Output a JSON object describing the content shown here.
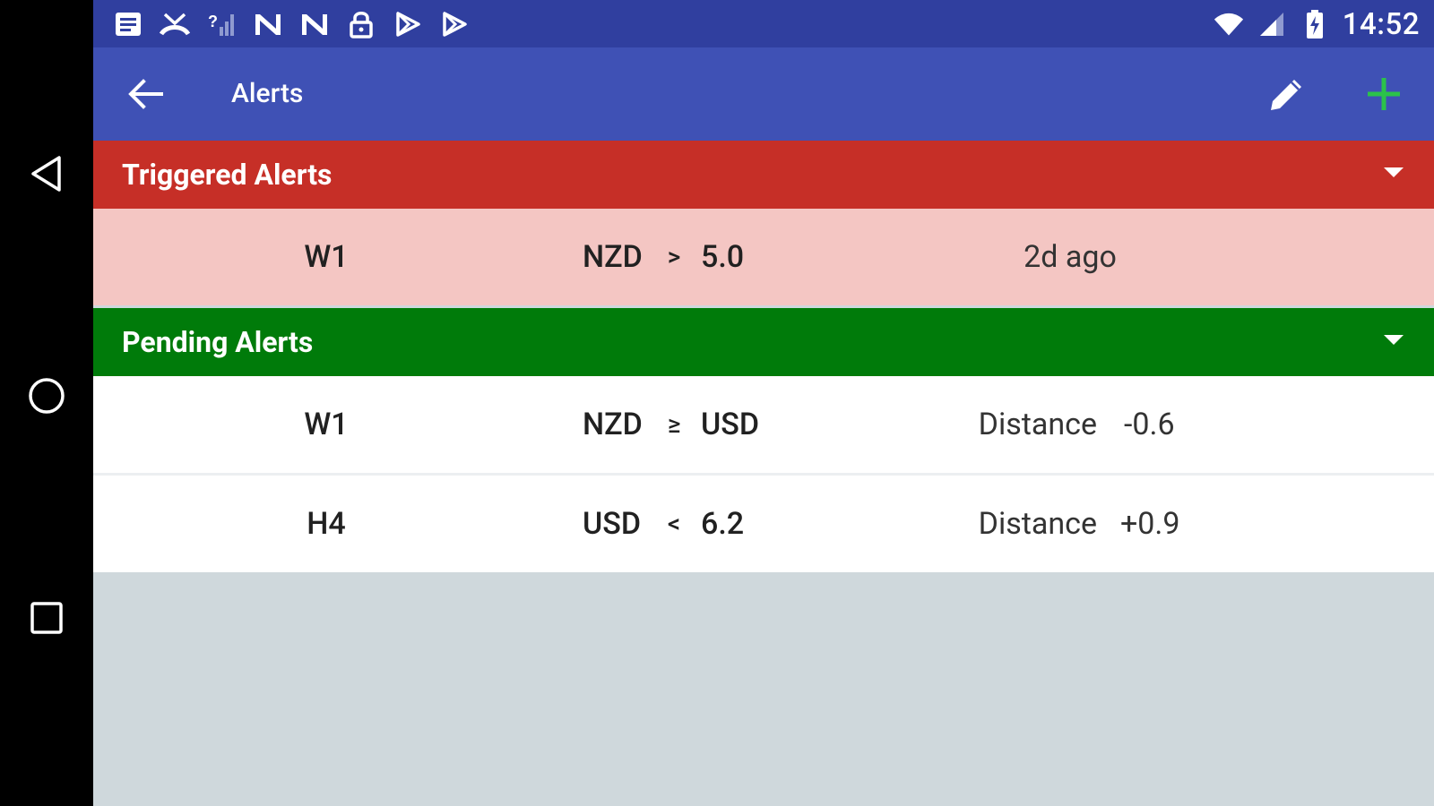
{
  "status_bar": {
    "time": "14:52",
    "notification_icons": [
      "message-icon",
      "missed-call-icon",
      "no-signal-icon",
      "n-app-icon",
      "n-app-icon",
      "lock-icon",
      "play-store-icon",
      "play-store-icon"
    ],
    "system_icons": [
      "wifi-icon",
      "signal-icon",
      "battery-charging-icon"
    ]
  },
  "toolbar": {
    "title": "Alerts",
    "back_icon": "arrow-back-icon",
    "edit_icon": "pencil-icon",
    "add_icon": "plus-icon"
  },
  "sections": {
    "triggered": {
      "title": "Triggered Alerts",
      "color": "#c62f27",
      "rows": [
        {
          "timeframe": "W1",
          "symbol": "NZD",
          "operator": ">",
          "value": "5.0",
          "info": "2d ago"
        }
      ]
    },
    "pending": {
      "title": "Pending Alerts",
      "color": "#007b0a",
      "rows": [
        {
          "timeframe": "W1",
          "symbol": "NZD",
          "operator": "≥",
          "value": "USD",
          "distance_label": "Distance",
          "distance": "-0.6"
        },
        {
          "timeframe": "H4",
          "symbol": "USD",
          "operator": "<",
          "value": "6.2",
          "distance_label": "Distance",
          "distance": "+0.9"
        }
      ]
    }
  },
  "colors": {
    "status_bar": "#303f9f",
    "toolbar": "#3f51b5",
    "triggered_row": "#f4c6c3",
    "add_icon": "#2bc24a",
    "background": "#cfd8dc"
  }
}
